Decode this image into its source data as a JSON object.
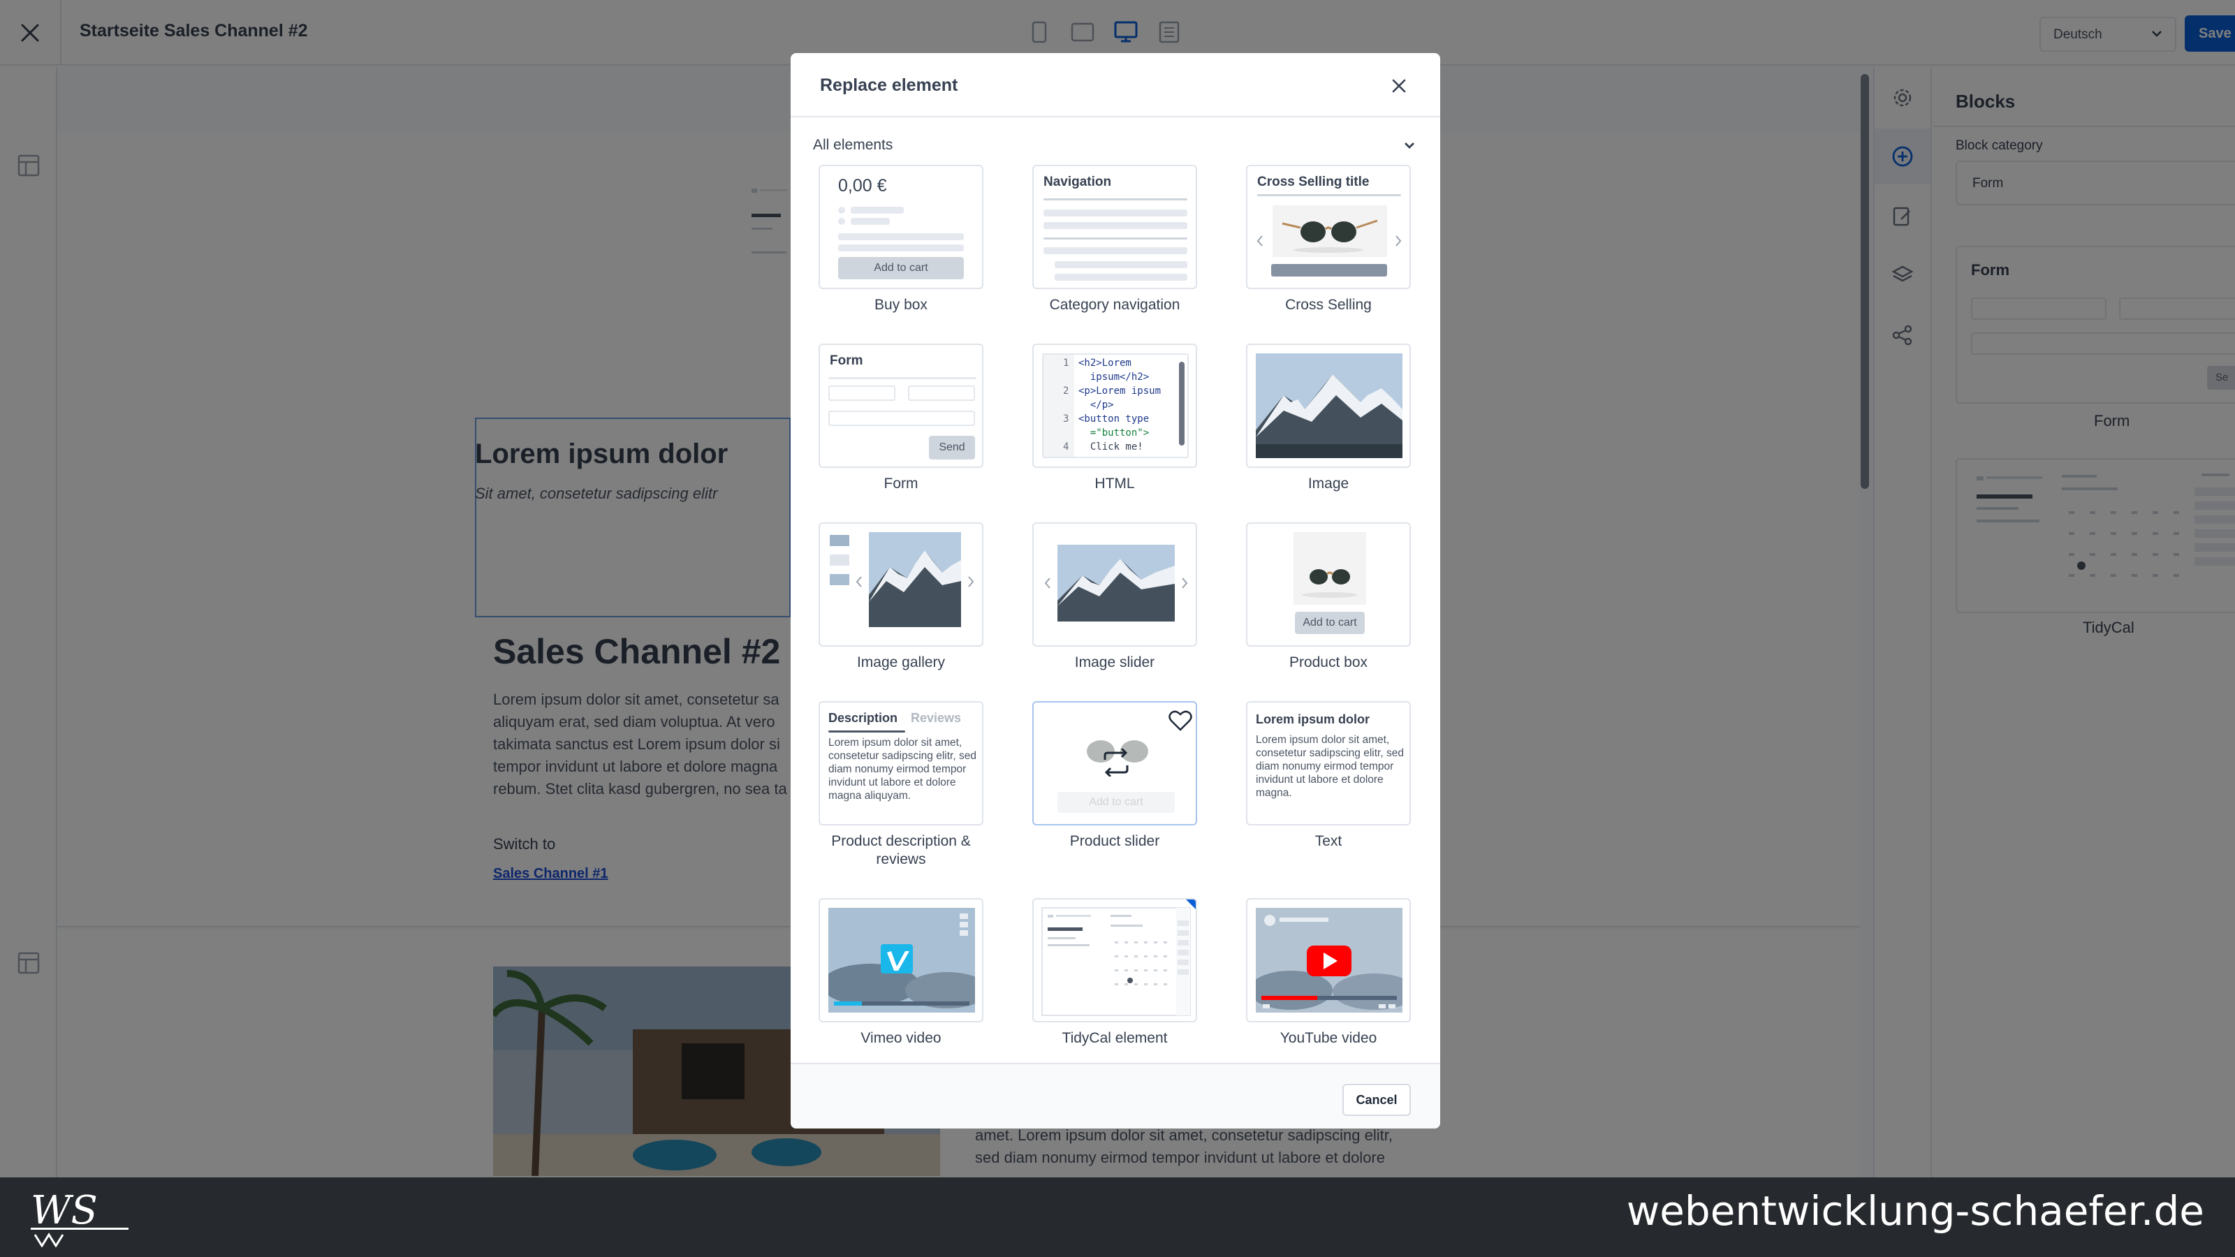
{
  "topbar": {
    "page_title": "Startseite Sales Channel #2",
    "language": "Deutsch",
    "save_label": "Save"
  },
  "canvas": {
    "hero_title": "Lorem ipsum dolor",
    "hero_subtitle": "Sit amet, consetetur sadipscing elitr",
    "section_title": "Sales Channel #2 -",
    "body_lines": [
      "Lorem ipsum dolor sit amet, consetetur sa",
      "aliquyam erat, sed diam voluptua. At vero",
      "takimata sanctus est Lorem ipsum dolor si",
      "tempor invidunt ut labore et dolore magna",
      "rebum. Stet clita kasd gubergren, no sea ta"
    ],
    "switch_to": "Switch to",
    "switch_link": "Sales Channel #1",
    "below_lines": [
      "amet. Lorem ipsum dolor sit amet, consetetur sadipscing elitr,",
      "sed diam nonumy eirmod tempor invidunt ut labore et dolore"
    ]
  },
  "sidebar": {
    "title": "Blocks",
    "category_label": "Block category",
    "category_value": "Form",
    "preview_form_title": "Form",
    "preview_form_send": "Se",
    "preview_labels": [
      "Form",
      "TidyCal"
    ]
  },
  "modal": {
    "title": "Replace element",
    "category_filter": "All elements",
    "cancel_label": "Cancel",
    "tiles": [
      {
        "label": "Buy box",
        "price": "0,00 €",
        "button": "Add to cart"
      },
      {
        "label": "Category navigation",
        "heading": "Navigation"
      },
      {
        "label": "Cross Selling",
        "heading": "Cross Selling title"
      },
      {
        "label": "Form",
        "heading": "Form",
        "button": "Send"
      },
      {
        "label": "HTML",
        "code": [
          "<h2>Lorem",
          "  ipsum</h2>",
          "<p>Lorem ipsum",
          "  </p>",
          "<button type",
          "  =\"button\">",
          "  Click me!"
        ],
        "line_numbers": [
          "1",
          "2",
          "3",
          "4"
        ]
      },
      {
        "label": "Image"
      },
      {
        "label": "Image gallery"
      },
      {
        "label": "Image slider"
      },
      {
        "label": "Product box",
        "button": "Add to cart"
      },
      {
        "label": "Product description & reviews",
        "tab1": "Description",
        "tab2": "Reviews",
        "text": "Lorem ipsum dolor sit amet, consetetur sadipscing elitr, sed diam nonumy eirmod tempor invidunt ut labore et dolore magna aliquyam."
      },
      {
        "label": "Product slider",
        "button": "Add to cart"
      },
      {
        "label": "Text",
        "heading": "Lorem ipsum dolor",
        "text": "Lorem ipsum dolor sit amet, consetetur sadipscing elitr, sed diam nonumy eirmod tempor invidunt ut labore et dolore magna."
      },
      {
        "label": "Vimeo video"
      },
      {
        "label": "TidyCal element"
      },
      {
        "label": "YouTube video"
      }
    ]
  },
  "brand": {
    "url": "webentwicklung-schaefer.de",
    "logo_text": "WS"
  },
  "colors": {
    "primary": "#0b5fd6",
    "overlay": "#000000",
    "youtube_red": "#ff0000",
    "vimeo_blue": "#1ab7ea"
  }
}
